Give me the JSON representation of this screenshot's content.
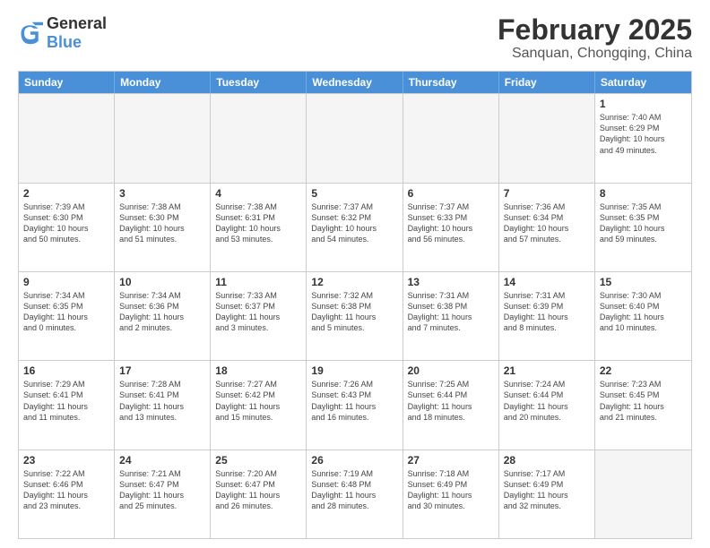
{
  "header": {
    "logo": {
      "text_general": "General",
      "text_blue": "Blue"
    },
    "title": "February 2025",
    "subtitle": "Sanquan, Chongqing, China"
  },
  "weekdays": [
    "Sunday",
    "Monday",
    "Tuesday",
    "Wednesday",
    "Thursday",
    "Friday",
    "Saturday"
  ],
  "weeks": [
    [
      {
        "day": "",
        "empty": true,
        "info": ""
      },
      {
        "day": "",
        "empty": true,
        "info": ""
      },
      {
        "day": "",
        "empty": true,
        "info": ""
      },
      {
        "day": "",
        "empty": true,
        "info": ""
      },
      {
        "day": "",
        "empty": true,
        "info": ""
      },
      {
        "day": "",
        "empty": true,
        "info": ""
      },
      {
        "day": "1",
        "empty": false,
        "info": "Sunrise: 7:40 AM\nSunset: 6:29 PM\nDaylight: 10 hours\nand 49 minutes."
      }
    ],
    [
      {
        "day": "2",
        "empty": false,
        "info": "Sunrise: 7:39 AM\nSunset: 6:30 PM\nDaylight: 10 hours\nand 50 minutes."
      },
      {
        "day": "3",
        "empty": false,
        "info": "Sunrise: 7:38 AM\nSunset: 6:30 PM\nDaylight: 10 hours\nand 51 minutes."
      },
      {
        "day": "4",
        "empty": false,
        "info": "Sunrise: 7:38 AM\nSunset: 6:31 PM\nDaylight: 10 hours\nand 53 minutes."
      },
      {
        "day": "5",
        "empty": false,
        "info": "Sunrise: 7:37 AM\nSunset: 6:32 PM\nDaylight: 10 hours\nand 54 minutes."
      },
      {
        "day": "6",
        "empty": false,
        "info": "Sunrise: 7:37 AM\nSunset: 6:33 PM\nDaylight: 10 hours\nand 56 minutes."
      },
      {
        "day": "7",
        "empty": false,
        "info": "Sunrise: 7:36 AM\nSunset: 6:34 PM\nDaylight: 10 hours\nand 57 minutes."
      },
      {
        "day": "8",
        "empty": false,
        "info": "Sunrise: 7:35 AM\nSunset: 6:35 PM\nDaylight: 10 hours\nand 59 minutes."
      }
    ],
    [
      {
        "day": "9",
        "empty": false,
        "info": "Sunrise: 7:34 AM\nSunset: 6:35 PM\nDaylight: 11 hours\nand 0 minutes."
      },
      {
        "day": "10",
        "empty": false,
        "info": "Sunrise: 7:34 AM\nSunset: 6:36 PM\nDaylight: 11 hours\nand 2 minutes."
      },
      {
        "day": "11",
        "empty": false,
        "info": "Sunrise: 7:33 AM\nSunset: 6:37 PM\nDaylight: 11 hours\nand 3 minutes."
      },
      {
        "day": "12",
        "empty": false,
        "info": "Sunrise: 7:32 AM\nSunset: 6:38 PM\nDaylight: 11 hours\nand 5 minutes."
      },
      {
        "day": "13",
        "empty": false,
        "info": "Sunrise: 7:31 AM\nSunset: 6:38 PM\nDaylight: 11 hours\nand 7 minutes."
      },
      {
        "day": "14",
        "empty": false,
        "info": "Sunrise: 7:31 AM\nSunset: 6:39 PM\nDaylight: 11 hours\nand 8 minutes."
      },
      {
        "day": "15",
        "empty": false,
        "info": "Sunrise: 7:30 AM\nSunset: 6:40 PM\nDaylight: 11 hours\nand 10 minutes."
      }
    ],
    [
      {
        "day": "16",
        "empty": false,
        "info": "Sunrise: 7:29 AM\nSunset: 6:41 PM\nDaylight: 11 hours\nand 11 minutes."
      },
      {
        "day": "17",
        "empty": false,
        "info": "Sunrise: 7:28 AM\nSunset: 6:41 PM\nDaylight: 11 hours\nand 13 minutes."
      },
      {
        "day": "18",
        "empty": false,
        "info": "Sunrise: 7:27 AM\nSunset: 6:42 PM\nDaylight: 11 hours\nand 15 minutes."
      },
      {
        "day": "19",
        "empty": false,
        "info": "Sunrise: 7:26 AM\nSunset: 6:43 PM\nDaylight: 11 hours\nand 16 minutes."
      },
      {
        "day": "20",
        "empty": false,
        "info": "Sunrise: 7:25 AM\nSunset: 6:44 PM\nDaylight: 11 hours\nand 18 minutes."
      },
      {
        "day": "21",
        "empty": false,
        "info": "Sunrise: 7:24 AM\nSunset: 6:44 PM\nDaylight: 11 hours\nand 20 minutes."
      },
      {
        "day": "22",
        "empty": false,
        "info": "Sunrise: 7:23 AM\nSunset: 6:45 PM\nDaylight: 11 hours\nand 21 minutes."
      }
    ],
    [
      {
        "day": "23",
        "empty": false,
        "info": "Sunrise: 7:22 AM\nSunset: 6:46 PM\nDaylight: 11 hours\nand 23 minutes."
      },
      {
        "day": "24",
        "empty": false,
        "info": "Sunrise: 7:21 AM\nSunset: 6:47 PM\nDaylight: 11 hours\nand 25 minutes."
      },
      {
        "day": "25",
        "empty": false,
        "info": "Sunrise: 7:20 AM\nSunset: 6:47 PM\nDaylight: 11 hours\nand 26 minutes."
      },
      {
        "day": "26",
        "empty": false,
        "info": "Sunrise: 7:19 AM\nSunset: 6:48 PM\nDaylight: 11 hours\nand 28 minutes."
      },
      {
        "day": "27",
        "empty": false,
        "info": "Sunrise: 7:18 AM\nSunset: 6:49 PM\nDaylight: 11 hours\nand 30 minutes."
      },
      {
        "day": "28",
        "empty": false,
        "info": "Sunrise: 7:17 AM\nSunset: 6:49 PM\nDaylight: 11 hours\nand 32 minutes."
      },
      {
        "day": "",
        "empty": true,
        "info": ""
      }
    ]
  ]
}
